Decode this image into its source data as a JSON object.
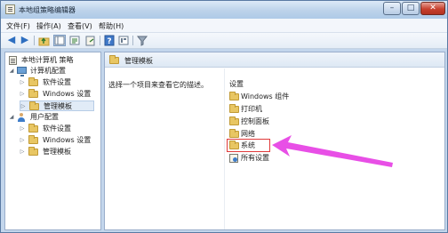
{
  "window": {
    "title": "本地组策略编辑器"
  },
  "menubar": {
    "items": [
      "文件(F)",
      "操作(A)",
      "查看(V)",
      "帮助(H)"
    ]
  },
  "tree": {
    "root": "本地计算机 策略",
    "computer_config": "计算机配置",
    "computer_children": [
      "软件设置",
      "Windows 设置",
      "管理模板"
    ],
    "user_config": "用户配置",
    "user_children": [
      "软件设置",
      "Windows 设置",
      "管理模板"
    ]
  },
  "main": {
    "header_title": "管理模板",
    "description": "选择一个项目来查看它的描述。",
    "list_header": "设置",
    "items": [
      "Windows 组件",
      "打印机",
      "控制面板",
      "网络",
      "系统",
      "所有设置"
    ]
  },
  "annotation": {
    "color": "#e84fe6",
    "highlight_color": "#e03a3a"
  }
}
